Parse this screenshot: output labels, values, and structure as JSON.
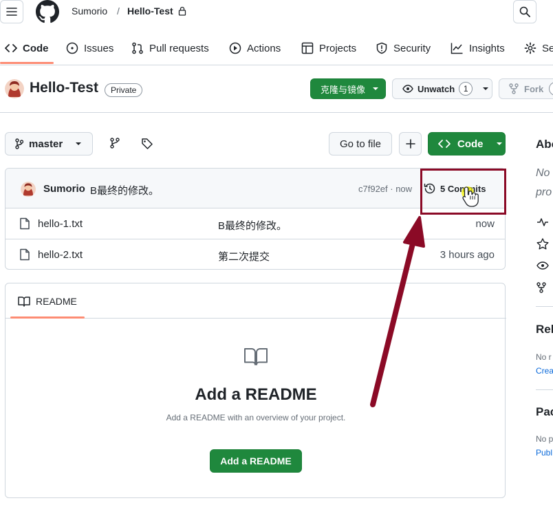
{
  "header": {
    "owner": "Sumorio",
    "separator": "/",
    "repo": "Hello-Test"
  },
  "nav_tabs": [
    {
      "label": "Code",
      "icon": "code-icon",
      "active": true
    },
    {
      "label": "Issues",
      "icon": "issue-opened-icon"
    },
    {
      "label": "Pull requests",
      "icon": "git-pull-request-icon"
    },
    {
      "label": "Actions",
      "icon": "play-icon"
    },
    {
      "label": "Projects",
      "icon": "table-icon"
    },
    {
      "label": "Security",
      "icon": "shield-icon"
    },
    {
      "label": "Insights",
      "icon": "graph-icon"
    },
    {
      "label": "Se",
      "icon": "gear-icon"
    }
  ],
  "repo": {
    "title": "Hello-Test",
    "visibility": "Private",
    "clone_label": "克隆与镜像",
    "watch_label": "Unwatch",
    "watch_count": "1",
    "fork_label": "Fork"
  },
  "file_nav": {
    "branch": "master",
    "go_to_file": "Go to file",
    "plus": "+",
    "code_label": "Code"
  },
  "latest_commit": {
    "author": "Sumorio",
    "message": "B最终的修改。",
    "hash_time": "c7f92ef · now",
    "commits_label": "5 Commits"
  },
  "files": [
    {
      "name": "hello-1.txt",
      "message": "B最终的修改。",
      "time": "now"
    },
    {
      "name": "hello-2.txt",
      "message": "第二次提交",
      "time": "3 hours ago"
    }
  ],
  "readme": {
    "tab_label": "README",
    "heading": "Add a README",
    "subtext": "Add a README with an overview of your project.",
    "button_label": "Add a README"
  },
  "sidebar": {
    "about_heading": "Abo",
    "about_desc_1": "No",
    "about_desc_2": "pro",
    "releases_heading": "Rel",
    "releases_text": "No r",
    "releases_link": "Crea",
    "packages_heading": "Pac",
    "packages_text": "No p",
    "packages_link": "Publ"
  },
  "colors": {
    "accent_green": "#1f883d",
    "tab_underline": "#fd8c73",
    "annotation_red": "#8b0a26",
    "link_blue": "#0969da"
  }
}
